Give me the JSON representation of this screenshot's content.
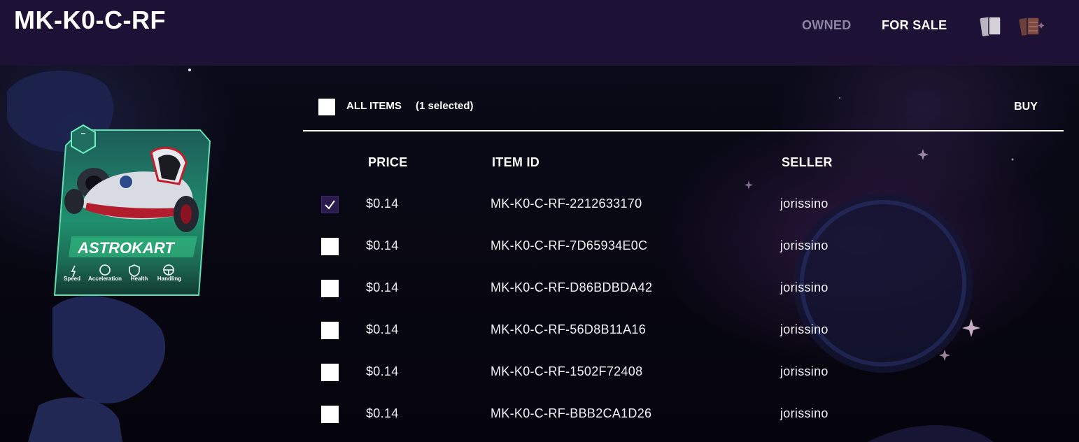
{
  "header": {
    "title": "MK-K0-C-RF",
    "nav": {
      "owned": "OWNED",
      "for_sale": "FOR SALE"
    },
    "icons": [
      "cards-icon",
      "gift-cards-icon"
    ]
  },
  "card": {
    "name": "ASTROKART",
    "badge": "–",
    "stats": [
      "Speed",
      "Acceleration",
      "Health",
      "Handling"
    ]
  },
  "toolbar": {
    "all_items": "ALL ITEMS",
    "selected": "(1 selected)",
    "buy": "BUY"
  },
  "table": {
    "columns": [
      "PRICE",
      "ITEM ID",
      "SELLER"
    ],
    "rows": [
      {
        "checked": true,
        "price": "$0.14",
        "id": "MK-K0-C-RF-2212633170",
        "seller": "jorissino"
      },
      {
        "checked": false,
        "price": "$0.14",
        "id": "MK-K0-C-RF-7D65934E0C",
        "seller": "jorissino"
      },
      {
        "checked": false,
        "price": "$0.14",
        "id": "MK-K0-C-RF-D86BDBDA42",
        "seller": "jorissino"
      },
      {
        "checked": false,
        "price": "$0.14",
        "id": "MK-K0-C-RF-56D8B11A16",
        "seller": "jorissino"
      },
      {
        "checked": false,
        "price": "$0.14",
        "id": "MK-K0-C-RF-1502F72408",
        "seller": "jorissino"
      },
      {
        "checked": false,
        "price": "$0.14",
        "id": "MK-K0-C-RF-BBB2CA1D26",
        "seller": "jorissino"
      }
    ]
  },
  "colors": {
    "header_bg": "#1e1136",
    "checked_box": "#2a1b4c",
    "card_accent": "#2fd38a"
  }
}
